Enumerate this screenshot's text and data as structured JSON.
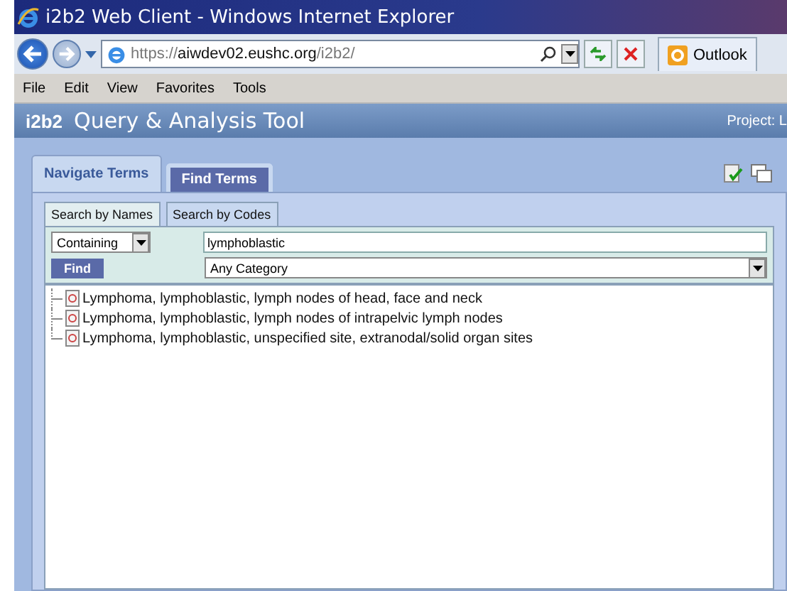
{
  "window": {
    "title": "i2b2 Web Client - Windows Internet Explorer"
  },
  "address_bar": {
    "url_prefix": "https://",
    "url_host": "aiwdev02.eushc.org",
    "url_path": "/i2b2/"
  },
  "favorite_tab": {
    "label": "Outlook"
  },
  "menu": [
    "File",
    "Edit",
    "View",
    "Favorites",
    "Tools"
  ],
  "app": {
    "logo": "i2b2",
    "title": "Query & Analysis Tool",
    "project": "Project: L"
  },
  "tabs": [
    {
      "label": "Navigate Terms",
      "selected": false
    },
    {
      "label": "Find Terms",
      "selected": true
    }
  ],
  "sub_tabs": [
    {
      "label": "Search by Names",
      "selected": true
    },
    {
      "label": "Search by Codes",
      "selected": false
    }
  ],
  "match_select": {
    "value": "Containing"
  },
  "search": {
    "value": "lymphoblastic"
  },
  "find_button": "Find",
  "category_select": {
    "value": "Any Category"
  },
  "results": [
    {
      "label": "Lymphoma, lymphoblastic, lymph nodes of head, face and neck"
    },
    {
      "label": "Lymphoma, lymphoblastic, lymph nodes of intrapelvic lymph nodes"
    },
    {
      "label": "Lymphoma, lymphoblastic, unspecified site, extranodal/solid organ sites"
    }
  ]
}
